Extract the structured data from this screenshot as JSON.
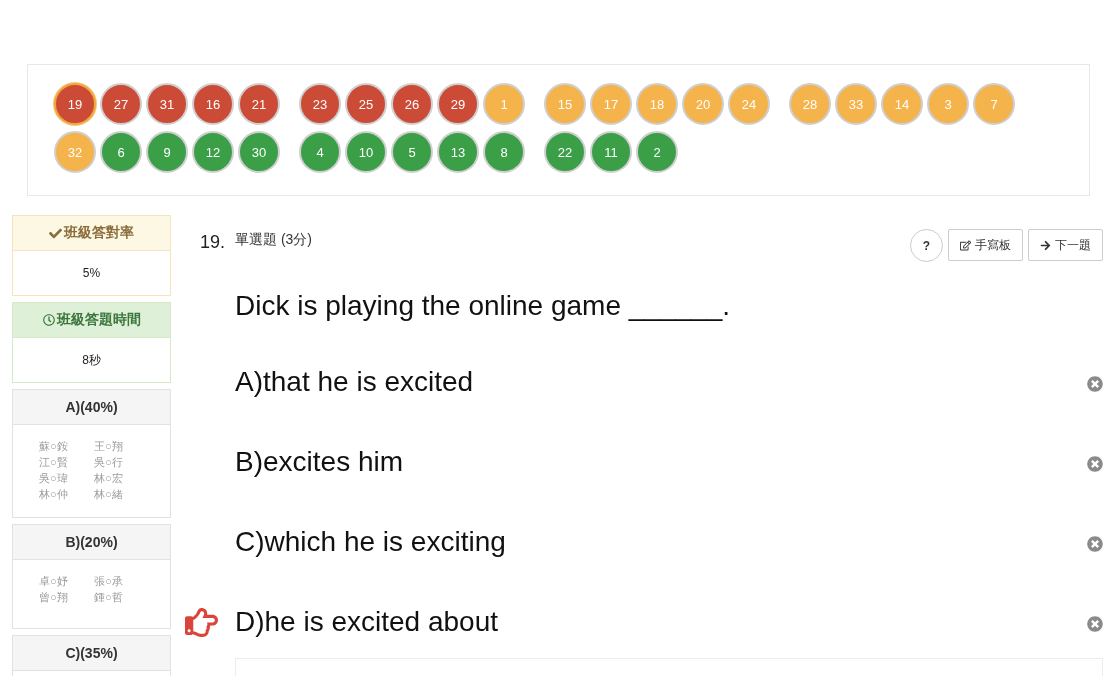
{
  "question_map": {
    "questions": [
      {
        "number": "19",
        "color": "#cc4b37",
        "selected": true
      },
      {
        "number": "27",
        "color": "#cc4b37",
        "selected": false
      },
      {
        "number": "31",
        "color": "#cc4b37",
        "selected": false
      },
      {
        "number": "16",
        "color": "#cc4b37",
        "selected": false
      },
      {
        "number": "21",
        "color": "#cc4b37",
        "selected": false
      },
      {
        "number": "23",
        "color": "#cc4b37",
        "selected": false
      },
      {
        "number": "25",
        "color": "#cc4b37",
        "selected": false
      },
      {
        "number": "26",
        "color": "#cc4b37",
        "selected": false
      },
      {
        "number": "29",
        "color": "#cc4b37",
        "selected": false
      },
      {
        "number": "1",
        "color": "#f5b34c",
        "selected": false
      },
      {
        "number": "15",
        "color": "#f5b34c",
        "selected": false
      },
      {
        "number": "17",
        "color": "#f5b34c",
        "selected": false
      },
      {
        "number": "18",
        "color": "#f5b34c",
        "selected": false
      },
      {
        "number": "20",
        "color": "#f5b34c",
        "selected": false
      },
      {
        "number": "24",
        "color": "#f5b34c",
        "selected": false
      },
      {
        "number": "28",
        "color": "#f5b34c",
        "selected": false
      },
      {
        "number": "33",
        "color": "#f5b34c",
        "selected": false
      },
      {
        "number": "14",
        "color": "#f5b34c",
        "selected": false
      },
      {
        "number": "3",
        "color": "#f5b34c",
        "selected": false
      },
      {
        "number": "7",
        "color": "#f5b34c",
        "selected": false
      },
      {
        "number": "32",
        "color": "#f5b34c",
        "selected": false
      },
      {
        "number": "6",
        "color": "#3b9f48",
        "selected": false
      },
      {
        "number": "9",
        "color": "#3b9f48",
        "selected": false
      },
      {
        "number": "12",
        "color": "#3b9f48",
        "selected": false
      },
      {
        "number": "30",
        "color": "#3b9f48",
        "selected": false
      },
      {
        "number": "4",
        "color": "#3b9f48",
        "selected": false
      },
      {
        "number": "10",
        "color": "#3b9f48",
        "selected": false
      },
      {
        "number": "5",
        "color": "#3b9f48",
        "selected": false
      },
      {
        "number": "13",
        "color": "#3b9f48",
        "selected": false
      },
      {
        "number": "8",
        "color": "#3b9f48",
        "selected": false
      },
      {
        "number": "22",
        "color": "#3b9f48",
        "selected": false
      },
      {
        "number": "11",
        "color": "#3b9f48",
        "selected": false
      },
      {
        "number": "2",
        "color": "#3b9f48",
        "selected": false
      }
    ]
  },
  "sidebar": {
    "cards": [
      {
        "kind": "correct_rate",
        "title": "班級答對率",
        "value": "5%"
      },
      {
        "kind": "answer_time",
        "title": "班級答題時間",
        "value": "8秒"
      },
      {
        "kind": "option",
        "title": "A)(40%)",
        "students": [
          "蘇○銨",
          "王○翔",
          "江○賢",
          "吳○行",
          "吳○瑋",
          "林○宏",
          "林○仲",
          "林○緒"
        ]
      },
      {
        "kind": "option",
        "title": "B)(20%)",
        "students": [
          "卓○妤",
          "張○承",
          "曾○翔",
          "鍾○哲"
        ]
      },
      {
        "kind": "option",
        "title": "C)(35%)"
      }
    ]
  },
  "question": {
    "number": "19.",
    "type": "單選題 (3分)",
    "buttons": [
      {
        "kind": "help",
        "label": "?"
      },
      {
        "kind": "handwriting",
        "label": "手寫板"
      },
      {
        "kind": "next",
        "label": "下一題"
      }
    ],
    "text": "Dick is playing the online game ______.",
    "options": [
      {
        "label": "A)that he is excited",
        "correct": false
      },
      {
        "label": "B)excites him",
        "correct": false
      },
      {
        "label": "C)which he is exciting",
        "correct": false
      },
      {
        "label": "D)he is excited about",
        "correct": true
      }
    ]
  }
}
